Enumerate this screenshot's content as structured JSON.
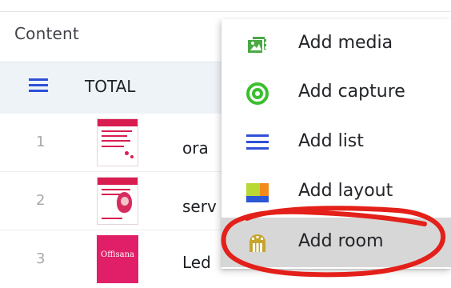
{
  "content": {
    "title": "Content",
    "total_label": "TOTAL",
    "rows": [
      {
        "number": "1",
        "name": "ora"
      },
      {
        "number": "2",
        "name": "serv"
      },
      {
        "number": "3",
        "name": "Led",
        "thumbnail_text": "Offisana"
      }
    ]
  },
  "menu": {
    "items": [
      {
        "label": "Add media",
        "icon": "media-icon"
      },
      {
        "label": "Add capture",
        "icon": "capture-icon"
      },
      {
        "label": "Add list",
        "icon": "list-icon"
      },
      {
        "label": "Add layout",
        "icon": "layout-icon"
      },
      {
        "label": "Add room",
        "icon": "room-icon"
      }
    ]
  },
  "colors": {
    "list_blue": "#2f4fd8",
    "capture_green": "#3bbf2f",
    "media_green": "#4aa944",
    "layout_lime": "#b8d833",
    "layout_orange": "#f28b1a",
    "layout_blue": "#2d58d5",
    "room_gold": "#c7a42b",
    "annotation_red": "#e32019",
    "active_menu_bg": "#d7d7d7"
  }
}
